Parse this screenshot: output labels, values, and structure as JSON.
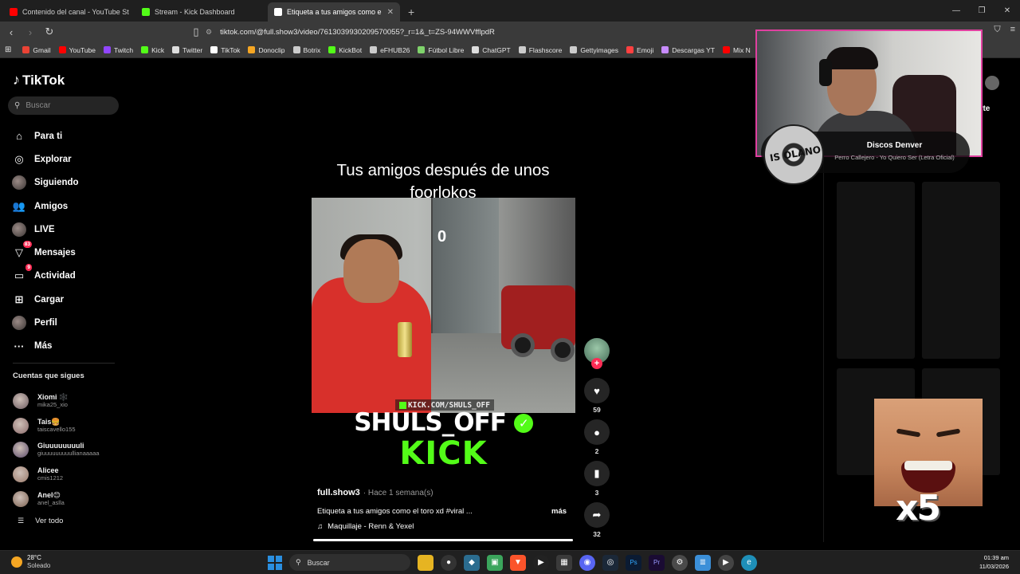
{
  "browser": {
    "tabs": [
      {
        "title": "Contenido del canal - YouTube Studio",
        "color": "#ff0000",
        "active": false
      },
      {
        "title": "Stream - Kick Dashboard",
        "color": "#53fc18",
        "active": false
      },
      {
        "title": "Etiqueta a tus amigos como e",
        "color": "#ffffff",
        "active": true
      }
    ],
    "url": "tiktok.com/@full.show3/video/7613039930209570055?_r=1&_t=ZS-94WWVfflpdR",
    "bookmarks": [
      {
        "label": "Gmail",
        "color": "#ea4335"
      },
      {
        "label": "YouTube",
        "color": "#ff0000"
      },
      {
        "label": "Twitch",
        "color": "#9146ff"
      },
      {
        "label": "Kick",
        "color": "#53fc18"
      },
      {
        "label": "Twitter",
        "color": "#dddddd"
      },
      {
        "label": "TikTok",
        "color": "#ffffff"
      },
      {
        "label": "Donoclip",
        "color": "#f5a623"
      },
      {
        "label": "Botrix",
        "color": "#cccccc"
      },
      {
        "label": "KickBot",
        "color": "#53fc18"
      },
      {
        "label": "eFHUB26",
        "color": "#cccccc"
      },
      {
        "label": "Fútbol Libre",
        "color": "#7fd36b"
      },
      {
        "label": "ChatGPT",
        "color": "#dddddd"
      },
      {
        "label": "Flashscore",
        "color": "#cccccc"
      },
      {
        "label": "Gettyimages",
        "color": "#cccccc"
      },
      {
        "label": "Emoji",
        "color": "#ff4040"
      },
      {
        "label": "Descargas YT",
        "color": "#c88cff"
      },
      {
        "label": "Mix N",
        "color": "#ff0000"
      }
    ]
  },
  "tiktok": {
    "logo": "TikTok",
    "search_placeholder": "Buscar",
    "menu": [
      {
        "label": "Para ti",
        "icon": "home-icon",
        "glyph": "⌂",
        "badge": ""
      },
      {
        "label": "Explorar",
        "icon": "compass-icon",
        "glyph": "◎",
        "badge": ""
      },
      {
        "label": "Siguiendo",
        "icon": "following-avatar-icon",
        "glyph": "",
        "badge": ""
      },
      {
        "label": "Amigos",
        "icon": "friends-icon",
        "glyph": "👥",
        "badge": ""
      },
      {
        "label": "LIVE",
        "icon": "live-avatar-icon",
        "glyph": "",
        "badge": ""
      },
      {
        "label": "Mensajes",
        "icon": "messages-icon",
        "glyph": "▽",
        "badge": "83"
      },
      {
        "label": "Actividad",
        "icon": "activity-icon",
        "glyph": "▭",
        "badge": "9"
      },
      {
        "label": "Cargar",
        "icon": "upload-icon",
        "glyph": "⊞",
        "badge": ""
      },
      {
        "label": "Perfil",
        "icon": "profile-avatar-icon",
        "glyph": "",
        "badge": ""
      },
      {
        "label": "Más",
        "icon": "more-icon",
        "glyph": "···",
        "badge": ""
      }
    ],
    "following_header": "Cuentas que sigues",
    "following": [
      {
        "name": "Xiomi 🕸️",
        "handle": "mika25_xio",
        "color": "#6b5a60"
      },
      {
        "name": "Tais🍔",
        "handle": "taiscavello155",
        "color": "#8a6a6a"
      },
      {
        "name": "Giuuuuuuuuli",
        "handle": "giuuuuuuuuullianaaaaa",
        "color": "#5a4a6a"
      },
      {
        "name": "Alicee",
        "handle": "cmis1212",
        "color": "#9a7a6a"
      },
      {
        "name": "Anel😊",
        "handle": "anel_aslla",
        "color": "#7a6050"
      }
    ],
    "see_all": "Ver todo",
    "video": {
      "title": "Tus amigos después de unos foorlokos",
      "overlay_digit": "0",
      "watermark": "KICK.COM/SHULS_OFF",
      "brand_name": "SHULS_OFF",
      "brand_platform": "KICK",
      "author": "full.show3",
      "posted": "· Hace 1 semana(s)",
      "caption": "Etiqueta a tus amigos como el toro xd #viral ...",
      "more": "más",
      "music": "Maquillaje - Renn & Yexel",
      "progress": 1.0
    },
    "actions": {
      "likes": "59",
      "comments": "2",
      "saves": "3",
      "shares": "32"
    },
    "behind_overlay_text": "arte"
  },
  "stream_overlay": {
    "now_playing_title": "Discos Denver",
    "now_playing_song": "Perro Callejero - Yo Quiero Ser (Letra Oficial)",
    "disc_text": "IS OLANO",
    "emote_text": "x5"
  },
  "taskbar": {
    "temp": "28°C",
    "weather": "Soleado",
    "search": "Buscar",
    "time": "01:39 am",
    "date": "11/03/2026"
  }
}
